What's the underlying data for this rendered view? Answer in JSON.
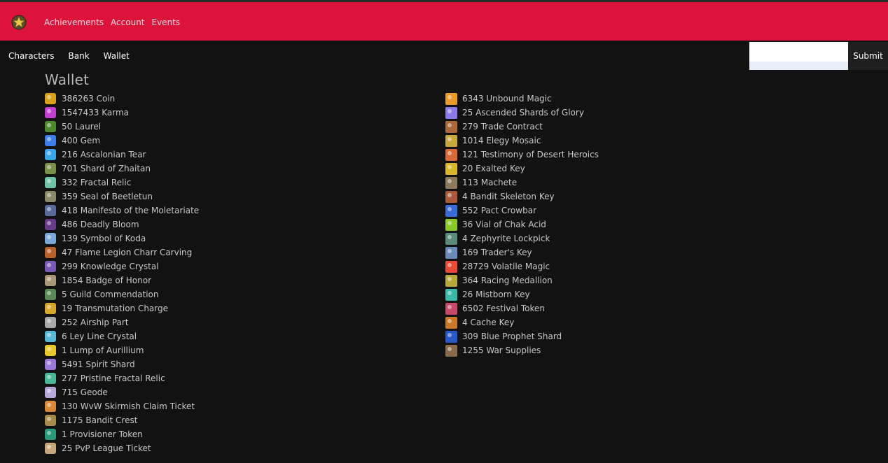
{
  "header": {
    "nav": [
      "Achievements",
      "Account",
      "Events"
    ]
  },
  "subnav": {
    "items": [
      "Characters",
      "Bank",
      "Wallet"
    ]
  },
  "search": {
    "value": "",
    "placeholder": "",
    "submit_label": "Submit"
  },
  "page_title": "Wallet",
  "wallet": {
    "left": [
      {
        "text": "386263 Coin",
        "icon": "coin-icon",
        "color": "#d9a21b"
      },
      {
        "text": "1547433 Karma",
        "icon": "karma-icon",
        "color": "#c23fd0"
      },
      {
        "text": "50 Laurel",
        "icon": "laurel-icon",
        "color": "#4d8a2f"
      },
      {
        "text": "400 Gem",
        "icon": "gem-icon",
        "color": "#3d7ee8"
      },
      {
        "text": "216 Ascalonian Tear",
        "icon": "ascalonian-tear-icon",
        "color": "#3aa8e8"
      },
      {
        "text": "701 Shard of Zhaitan",
        "icon": "shard-of-zhaitan-icon",
        "color": "#7a8f4a"
      },
      {
        "text": "332 Fractal Relic",
        "icon": "fractal-relic-icon",
        "color": "#6fc3a8"
      },
      {
        "text": "359 Seal of Beetletun",
        "icon": "seal-of-beetletun-icon",
        "color": "#8a8a6a"
      },
      {
        "text": "418 Manifesto of the Moletariate",
        "icon": "manifesto-icon",
        "color": "#5a6a9a"
      },
      {
        "text": "486 Deadly Bloom",
        "icon": "deadly-bloom-icon",
        "color": "#6a3a8a"
      },
      {
        "text": "139 Symbol of Koda",
        "icon": "symbol-of-koda-icon",
        "color": "#7aa8d8"
      },
      {
        "text": "47 Flame Legion Charr Carving",
        "icon": "charr-carving-icon",
        "color": "#b8612a"
      },
      {
        "text": "299 Knowledge Crystal",
        "icon": "knowledge-crystal-icon",
        "color": "#7a5ab8"
      },
      {
        "text": "1854 Badge of Honor",
        "icon": "badge-of-honor-icon",
        "color": "#a89878"
      },
      {
        "text": "5 Guild Commendation",
        "icon": "guild-commendation-icon",
        "color": "#5a8a5a"
      },
      {
        "text": "19 Transmutation Charge",
        "icon": "transmutation-charge-icon",
        "color": "#d8a82a"
      },
      {
        "text": "252 Airship Part",
        "icon": "airship-part-icon",
        "color": "#a8a8a8"
      },
      {
        "text": "6 Ley Line Crystal",
        "icon": "ley-line-crystal-icon",
        "color": "#5ab8d8"
      },
      {
        "text": "1 Lump of Aurillium",
        "icon": "aurillium-icon",
        "color": "#e8c82a"
      },
      {
        "text": "5491 Spirit Shard",
        "icon": "spirit-shard-icon",
        "color": "#9a7ad8"
      },
      {
        "text": "277 Pristine Fractal Relic",
        "icon": "pristine-fractal-relic-icon",
        "color": "#4ab898"
      },
      {
        "text": "715 Geode",
        "icon": "geode-icon",
        "color": "#b8a8d8"
      },
      {
        "text": "130 WvW Skirmish Claim Ticket",
        "icon": "skirmish-ticket-icon",
        "color": "#d88a3a"
      },
      {
        "text": "1175 Bandit Crest",
        "icon": "bandit-crest-icon",
        "color": "#a88a4a"
      },
      {
        "text": "1 Provisioner Token",
        "icon": "provisioner-token-icon",
        "color": "#2a9a7a"
      },
      {
        "text": "25 PvP League Ticket",
        "icon": "pvp-league-ticket-icon",
        "color": "#c8a87a"
      }
    ],
    "right": [
      {
        "text": "6343 Unbound Magic",
        "icon": "unbound-magic-icon",
        "color": "#e89a2a"
      },
      {
        "text": "25 Ascended Shards of Glory",
        "icon": "shards-of-glory-icon",
        "color": "#8a7ae8"
      },
      {
        "text": "279 Trade Contract",
        "icon": "trade-contract-icon",
        "color": "#a8683a"
      },
      {
        "text": "1014 Elegy Mosaic",
        "icon": "elegy-mosaic-icon",
        "color": "#c8a83a"
      },
      {
        "text": "121 Testimony of Desert Heroics",
        "icon": "desert-heroics-icon",
        "color": "#d86a3a"
      },
      {
        "text": "20 Exalted Key",
        "icon": "exalted-key-icon",
        "color": "#d8b82a"
      },
      {
        "text": "113 Machete",
        "icon": "machete-icon",
        "color": "#8a7a5a"
      },
      {
        "text": "4 Bandit Skeleton Key",
        "icon": "bandit-skeleton-key-icon",
        "color": "#a85a3a"
      },
      {
        "text": "552 Pact Crowbar",
        "icon": "pact-crowbar-icon",
        "color": "#3a6ad8"
      },
      {
        "text": "36 Vial of Chak Acid",
        "icon": "chak-acid-icon",
        "color": "#8ac82a"
      },
      {
        "text": "4 Zephyrite Lockpick",
        "icon": "zephyrite-lockpick-icon",
        "color": "#5a8a7a"
      },
      {
        "text": "169 Trader's Key",
        "icon": "traders-key-icon",
        "color": "#6a8ab8"
      },
      {
        "text": "28729 Volatile Magic",
        "icon": "volatile-magic-icon",
        "color": "#e84a3a"
      },
      {
        "text": "364 Racing Medallion",
        "icon": "racing-medallion-icon",
        "color": "#b8a83a"
      },
      {
        "text": "26 Mistborn Key",
        "icon": "mistborn-key-icon",
        "color": "#3ab8a8"
      },
      {
        "text": "6502 Festival Token",
        "icon": "festival-token-icon",
        "color": "#c84a6a"
      },
      {
        "text": "4 Cache Key",
        "icon": "cache-key-icon",
        "color": "#c87a2a"
      },
      {
        "text": "309 Blue Prophet Shard",
        "icon": "blue-prophet-shard-icon",
        "color": "#2a5ac8"
      },
      {
        "text": "1255 War Supplies",
        "icon": "war-supplies-icon",
        "color": "#8a6a4a"
      }
    ]
  }
}
